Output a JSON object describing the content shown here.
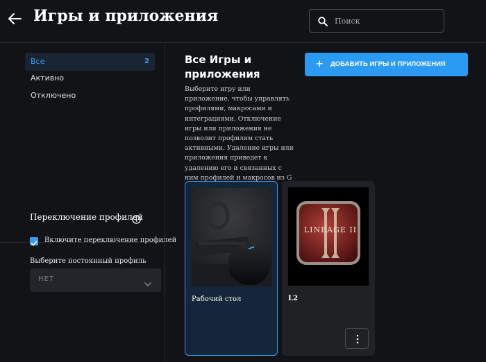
{
  "window": {
    "minimize": "–",
    "maximize": "□",
    "close": "✕"
  },
  "header": {
    "title": "Игры и приложения"
  },
  "search": {
    "placeholder": "Поиск"
  },
  "sidebar": {
    "items": [
      {
        "label": "Все",
        "count": "2"
      },
      {
        "label": "Активно"
      },
      {
        "label": "Отключено"
      }
    ],
    "profile_switch": {
      "title": "Переключение профилей",
      "checkbox_label": "Включите переключение профилей",
      "checked": true,
      "default_profile_label": "Выберите постоянный профиль",
      "default_profile_value": "НЕТ"
    }
  },
  "main": {
    "title": "Все Игры и приложения",
    "description": "Выберите игру или приложение, чтобы управлять профилями, макросами и интеграциями. Отключение игры или приложения не позволит профилям стать активными. Удаление игры или приложения приведет к удалению его и связанных с ним профилей и макросов из G HUB.",
    "add_button": "ДОБАВИТЬ ИГРЫ И ПРИЛОЖЕНИЯ",
    "cards": [
      {
        "name": "Рабочий стол",
        "selected": true
      },
      {
        "name": "L2",
        "selected": false,
        "logo_text": "LINEAGE II"
      }
    ]
  },
  "colors": {
    "accent": "#2b9af3",
    "background": "#121316",
    "card": "#1f2125"
  }
}
